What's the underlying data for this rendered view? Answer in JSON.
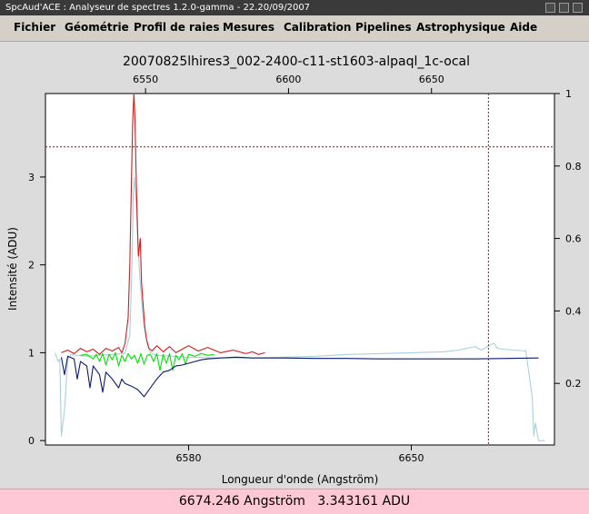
{
  "window": {
    "title": "SpcAud'ACE : Analyseur de spectres 1.2.0-gamma - 22.20/09/2007"
  },
  "menu": [
    {
      "label": "Fichier"
    },
    {
      "label": "Géométrie"
    },
    {
      "label": "Profil de raies"
    },
    {
      "label": "Mesures"
    },
    {
      "label": "Calibration"
    },
    {
      "label": "Pipelines"
    },
    {
      "label": "Astrophysique"
    },
    {
      "label": "Aide"
    }
  ],
  "status": {
    "wavelength": "6674.246 Angström",
    "intensity": "3.343161 ADU"
  },
  "chart_data": {
    "type": "line",
    "title": "20070825lhires3_002-2400-c11-st1603-alpaql_1c-ocal",
    "xlabel": "Longueur d'onde (Angström)",
    "ylabel": "Intensité (ADU)",
    "bottom_axis": {
      "range": [
        6535,
        6695
      ],
      "tick_labels": [
        "6580",
        "6650"
      ],
      "tick_values": [
        6580,
        6650
      ]
    },
    "top_axis": {
      "range": [
        6515,
        6693
      ],
      "tick_labels": [
        "6550",
        "6600",
        "6650"
      ],
      "tick_values": [
        6550,
        6600,
        6650
      ]
    },
    "left_axis": {
      "range": [
        -0.05,
        3.95
      ],
      "tick_labels": [
        "0",
        "1",
        "2",
        "3"
      ],
      "tick_values": [
        0,
        1,
        2,
        3
      ]
    },
    "right_axis": {
      "range": [
        0.03,
        1.0
      ],
      "tick_labels": [
        "0.2",
        "0.4",
        "0.6",
        "0.8",
        "1"
      ],
      "tick_values": [
        0.2,
        0.4,
        0.6,
        0.8,
        1.0
      ]
    },
    "crosshair": {
      "x": 6674.246,
      "y": 3.343161,
      "color": "#b00000"
    },
    "colors": {
      "red": "#d21c1c",
      "green": "#00e000",
      "navy": "#0a1a6e",
      "lightblue": "#a9d0dc",
      "axis": "#000000"
    },
    "series": [
      {
        "color": "#a9d0dc",
        "x": [
          6538,
          6539,
          6539.5,
          6540,
          6541,
          6542,
          6543,
          6545,
          6548,
          6552,
          6556,
          6560,
          6561.5,
          6562.2,
          6562.6,
          6563,
          6563.5,
          6564,
          6564.6,
          6565.2,
          6566,
          6567,
          6568,
          6570,
          6575,
          6580,
          6590,
          6600,
          6610,
          6620,
          6630,
          6640,
          6650,
          6660,
          6665,
          6670,
          6672,
          6674,
          6676,
          6677,
          6679,
          6682,
          6686,
          6688,
          6688.5,
          6689,
          6690,
          6691,
          6692
        ],
        "y": [
          1.0,
          0.9,
          0.93,
          0.05,
          0.35,
          0.92,
          0.98,
          0.97,
          0.96,
          0.97,
          0.98,
          0.99,
          1.2,
          2.0,
          2.8,
          3.0,
          2.7,
          2.3,
          1.9,
          1.6,
          1.3,
          1.1,
          1.0,
          0.97,
          0.96,
          0.95,
          0.94,
          0.94,
          0.95,
          0.96,
          0.98,
          0.99,
          1.0,
          1.01,
          1.03,
          1.07,
          1.03,
          1.07,
          1.11,
          1.05,
          1.04,
          1.03,
          1.02,
          0.5,
          0.05,
          0.2,
          0.0,
          0.0,
          0.0
        ]
      },
      {
        "color": "#d21c1c",
        "x": [
          6540,
          6542,
          6544,
          6546,
          6548,
          6550,
          6552,
          6554,
          6556,
          6558,
          6559,
          6560,
          6561,
          6561.5,
          6562,
          6562.4,
          6562.8,
          6563.1,
          6563.4,
          6563.8,
          6564.2,
          6564.8,
          6565.2,
          6565.6,
          6566.2,
          6566.8,
          6567.5,
          6568.5,
          6570,
          6572,
          6574,
          6576,
          6578,
          6580,
          6583,
          6586,
          6590,
          6594,
          6598,
          6600,
          6602,
          6604
        ],
        "y": [
          1.0,
          1.03,
          0.99,
          1.05,
          1.01,
          1.04,
          0.98,
          1.05,
          1.02,
          1.06,
          1.0,
          1.1,
          1.4,
          2.0,
          2.9,
          3.6,
          3.95,
          3.7,
          3.2,
          2.6,
          2.1,
          2.3,
          1.8,
          1.6,
          1.3,
          1.15,
          1.05,
          1.02,
          1.08,
          1.01,
          1.07,
          1.0,
          1.04,
          1.08,
          1.02,
          1.06,
          1.0,
          1.03,
          0.99,
          1.01,
          0.98,
          1.0
        ]
      },
      {
        "color": "#00e000",
        "x": [
          6546,
          6548,
          6550,
          6551,
          6552,
          6553,
          6554,
          6555,
          6556,
          6557,
          6558,
          6559,
          6560,
          6561,
          6562,
          6563,
          6564,
          6565,
          6566,
          6567,
          6568,
          6569,
          6570,
          6571,
          6572,
          6573,
          6574,
          6575,
          6576,
          6577,
          6578,
          6579,
          6580,
          6582,
          6584,
          6586,
          6588
        ],
        "y": [
          0.97,
          0.98,
          0.93,
          0.98,
          0.9,
          0.99,
          0.86,
          0.98,
          0.92,
          1.0,
          0.85,
          0.97,
          0.9,
          0.99,
          0.93,
          0.97,
          0.88,
          0.99,
          0.87,
          0.97,
          0.98,
          0.9,
          0.99,
          0.8,
          0.98,
          0.88,
          0.99,
          0.8,
          0.97,
          0.92,
          0.99,
          0.87,
          0.98,
          0.96,
          0.99,
          0.97,
          0.98
        ]
      },
      {
        "color": "#0a1a6e",
        "x": [
          6540,
          6541,
          6542,
          6544,
          6545,
          6546,
          6548,
          6549,
          6550,
          6552,
          6553,
          6554,
          6556,
          6558,
          6559,
          6560,
          6562,
          6564,
          6566,
          6567,
          6568,
          6570,
          6572,
          6574,
          6576,
          6578,
          6580,
          6582,
          6584,
          6586,
          6590,
          6595,
          6600,
          6610,
          6620,
          6630,
          6640,
          6650,
          6660,
          6670,
          6680,
          6690
        ],
        "y": [
          0.95,
          0.75,
          0.96,
          0.93,
          0.7,
          0.9,
          0.85,
          0.6,
          0.85,
          0.75,
          0.55,
          0.78,
          0.7,
          0.6,
          0.7,
          0.65,
          0.62,
          0.58,
          0.5,
          0.55,
          0.6,
          0.7,
          0.78,
          0.8,
          0.85,
          0.86,
          0.88,
          0.9,
          0.92,
          0.93,
          0.94,
          0.95,
          0.94,
          0.94,
          0.935,
          0.935,
          0.93,
          0.93,
          0.93,
          0.93,
          0.935,
          0.94
        ]
      }
    ]
  }
}
